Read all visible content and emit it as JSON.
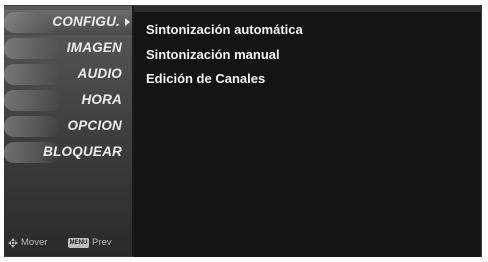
{
  "sidebar": {
    "items": [
      {
        "label": "CONFIGU.",
        "selected": true
      },
      {
        "label": "IMAGEN",
        "selected": false
      },
      {
        "label": "AUDIO",
        "selected": false
      },
      {
        "label": "HORA",
        "selected": false
      },
      {
        "label": "OPCION",
        "selected": false
      },
      {
        "label": "BLOQUEAR",
        "selected": false
      }
    ],
    "footer": {
      "move_label": "Mover",
      "key_label": "MENU",
      "prev_label": "Prev"
    }
  },
  "submenu": {
    "items": [
      "Sintonización automática",
      "Sintonización manual",
      "Edición de Canales"
    ]
  },
  "colors": {
    "background": "#1a1a1a",
    "text": "#f2f2f2",
    "sidebar": "#4a4a4a"
  }
}
